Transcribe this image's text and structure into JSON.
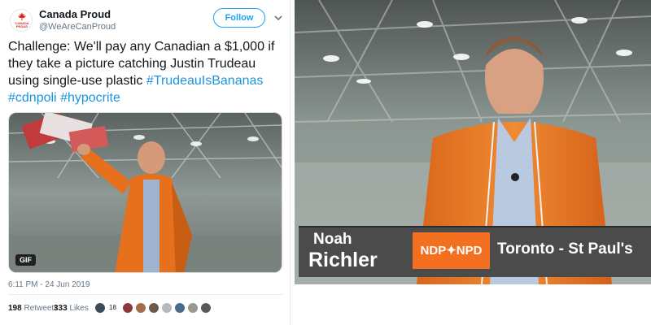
{
  "tweet": {
    "author_name": "Canada Proud",
    "author_handle": "@WeAreCanProud",
    "avatar_text": "CANADA PROUD",
    "follow_label": "Follow",
    "text_plain": "Challenge: We'll pay any Canadian a $1,000 if they take a picture catching Justin Trudeau using single-use plastic ",
    "hashtags": [
      "#TrudeauIsBananas",
      "#cdnpoli",
      "#hypocrite"
    ],
    "media_badge": "GIF",
    "timestamp": "6:11 PM - 24 Jun 2019",
    "retweets_count": "198",
    "retweets_label": "Retweets",
    "likes_count": "333",
    "likes_label": "Likes",
    "likers_extra": "18"
  },
  "video_frame": {
    "first_name": "Noah",
    "last_name": "Richler",
    "party_logo_text": "NDP✦NPD",
    "riding": "Toronto - St Paul's"
  },
  "colors": {
    "twitter_blue": "#1da1f2",
    "ndp_orange": "#f37021",
    "lower_third_gray": "#4b4b4b"
  }
}
